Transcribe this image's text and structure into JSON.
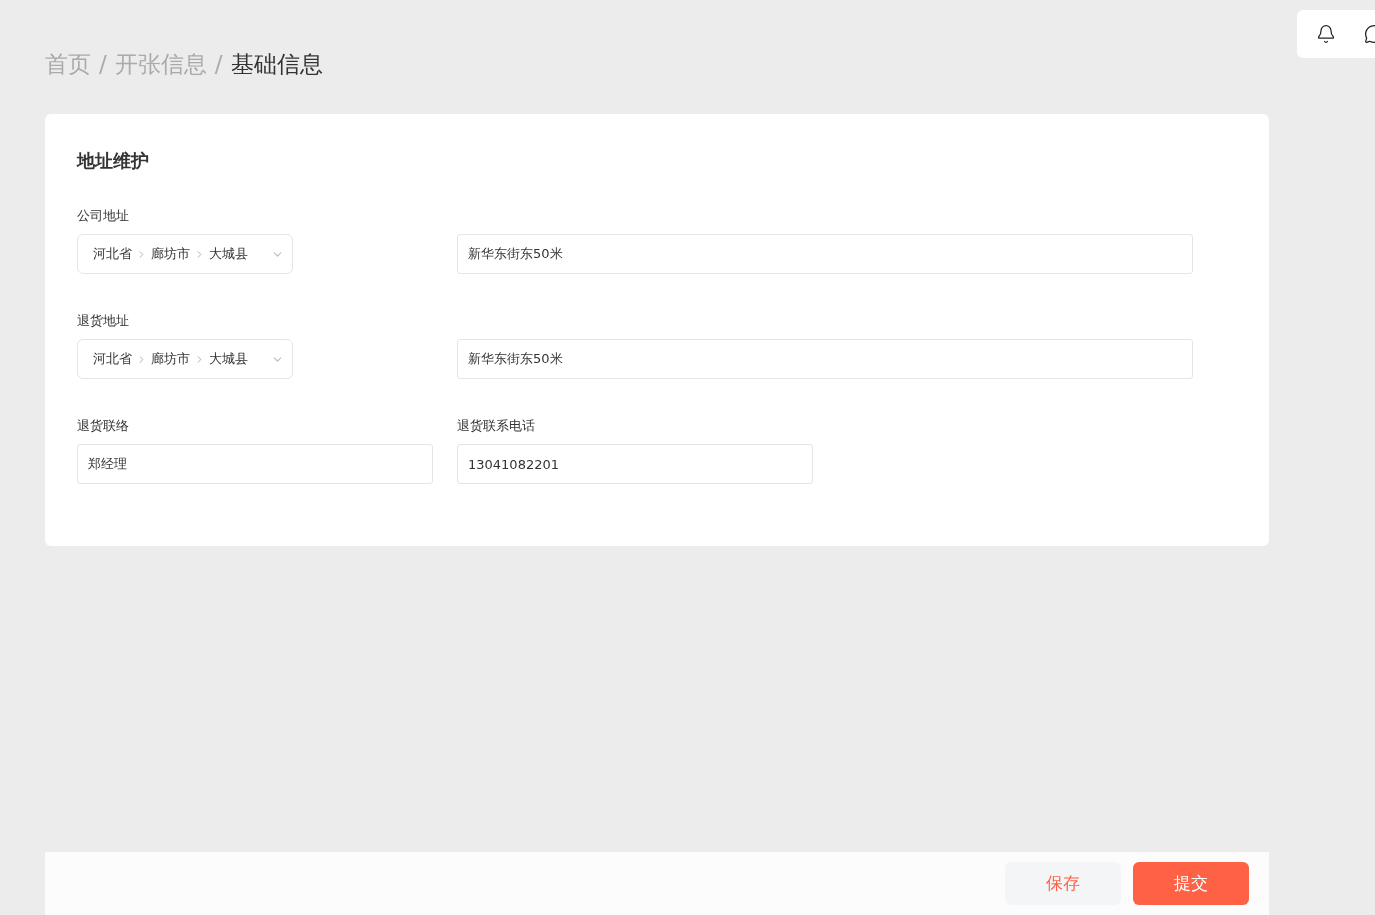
{
  "breadcrumb": [
    {
      "label": "首页",
      "current": false
    },
    {
      "label": "开张信息",
      "current": false
    },
    {
      "label": "基础信息",
      "current": true
    }
  ],
  "separator": "/",
  "card": {
    "title": "地址维护",
    "sections": [
      {
        "kind": "address",
        "label": "公司地址",
        "region": [
          "河北省",
          "廊坊市",
          "大城县"
        ],
        "detail": "新华东街东50米"
      },
      {
        "kind": "address",
        "label": "退货地址",
        "region": [
          "河北省",
          "廊坊市",
          "大城县"
        ],
        "detail": "新华东街东50米"
      },
      {
        "kind": "pair",
        "fields": [
          {
            "label": "退货联络",
            "value": "郑经理"
          },
          {
            "label": "退货联系电话",
            "value": "13041082201"
          }
        ]
      }
    ]
  },
  "footer": {
    "buttons": [
      {
        "label": "保存",
        "kind": "secondary"
      },
      {
        "label": "提交",
        "kind": "primary"
      }
    ]
  }
}
